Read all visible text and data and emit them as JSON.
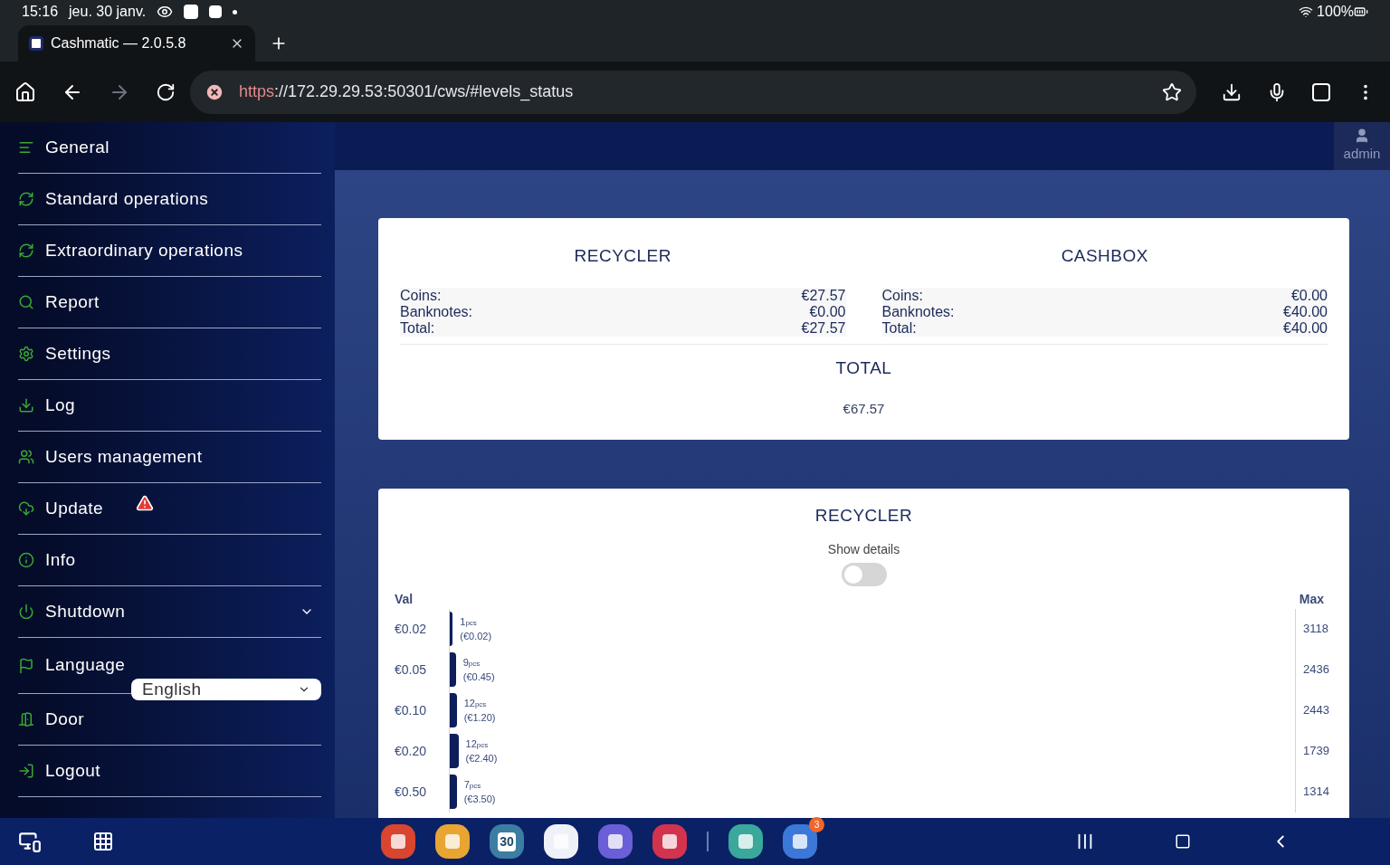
{
  "status_bar": {
    "time": "15:16",
    "date": "jeu. 30 janv.",
    "battery": "100%"
  },
  "browser": {
    "tab": {
      "title": "Cashmatic — 2.0.5.8",
      "selected": true
    },
    "url_scheme": "https",
    "url_rest": "://172.29.29.53:50301/cws/#levels_status",
    "insecure": true
  },
  "sidebar": {
    "items": [
      {
        "label": "General",
        "warning": false,
        "dropdown": false
      },
      {
        "label": "Standard operations",
        "warning": false,
        "dropdown": false
      },
      {
        "label": "Extraordinary operations",
        "warning": false,
        "dropdown": false
      },
      {
        "label": "Report",
        "warning": false,
        "dropdown": false
      },
      {
        "label": "Settings",
        "warning": false,
        "dropdown": false
      },
      {
        "label": "Log",
        "warning": false,
        "dropdown": false
      },
      {
        "label": "Users management",
        "warning": false,
        "dropdown": false
      },
      {
        "label": "Update",
        "warning": true,
        "dropdown": false
      },
      {
        "label": "Info",
        "warning": false,
        "dropdown": false
      },
      {
        "label": "Shutdown",
        "warning": false,
        "dropdown": true
      },
      {
        "label": "Language",
        "warning": false,
        "dropdown": false,
        "select": "English"
      },
      {
        "label": "Door",
        "warning": false,
        "dropdown": false
      },
      {
        "label": "Logout",
        "warning": false,
        "dropdown": false
      }
    ]
  },
  "user": {
    "name": "admin"
  },
  "summary": {
    "sections": [
      {
        "title": "RECYCLER",
        "rows": [
          {
            "label": "Coins:",
            "value": "€27.57"
          },
          {
            "label": "Banknotes:",
            "value": "€0.00"
          },
          {
            "label": "Total:",
            "value": "€27.57"
          }
        ]
      },
      {
        "title": "CASHBOX",
        "rows": [
          {
            "label": "Coins:",
            "value": "€0.00"
          },
          {
            "label": "Banknotes:",
            "value": "€40.00"
          },
          {
            "label": "Total:",
            "value": "€40.00"
          }
        ]
      }
    ],
    "total_title": "TOTAL",
    "total": "€67.57"
  },
  "recycler": {
    "title": "RECYCLER",
    "toggle_label": "Show details",
    "show_details": false,
    "val_header": "Val",
    "max_header": "Max",
    "rows": [
      {
        "val": "€0.02",
        "pcs": "1",
        "unit": "pcs",
        "amount": "(€0.02)",
        "max": "3118",
        "level": 0.0003
      },
      {
        "val": "€0.05",
        "pcs": "9",
        "unit": "pcs",
        "amount": "(€0.45)",
        "max": "2436",
        "level": 0.004
      },
      {
        "val": "€0.10",
        "pcs": "12",
        "unit": "pcs",
        "amount": "(€1.20)",
        "max": "2443",
        "level": 0.005
      },
      {
        "val": "€0.20",
        "pcs": "12",
        "unit": "pcs",
        "amount": "(€2.40)",
        "max": "1739",
        "level": 0.007
      },
      {
        "val": "€0.50",
        "pcs": "7",
        "unit": "pcs",
        "amount": "(€3.50)",
        "max": "1314",
        "level": 0.005
      }
    ]
  },
  "taskbar": {
    "apps": [
      {
        "color": "#d9452f"
      },
      {
        "color": "#e8a531"
      },
      {
        "color": "#3b7ea1",
        "label": "30"
      },
      {
        "color": "#eef2f8"
      },
      {
        "color": "#6a5fd6"
      },
      {
        "color": "#d4334d"
      },
      {
        "color": "#3aa89a"
      },
      {
        "color": "#3c78d8",
        "badge": "3"
      }
    ]
  }
}
